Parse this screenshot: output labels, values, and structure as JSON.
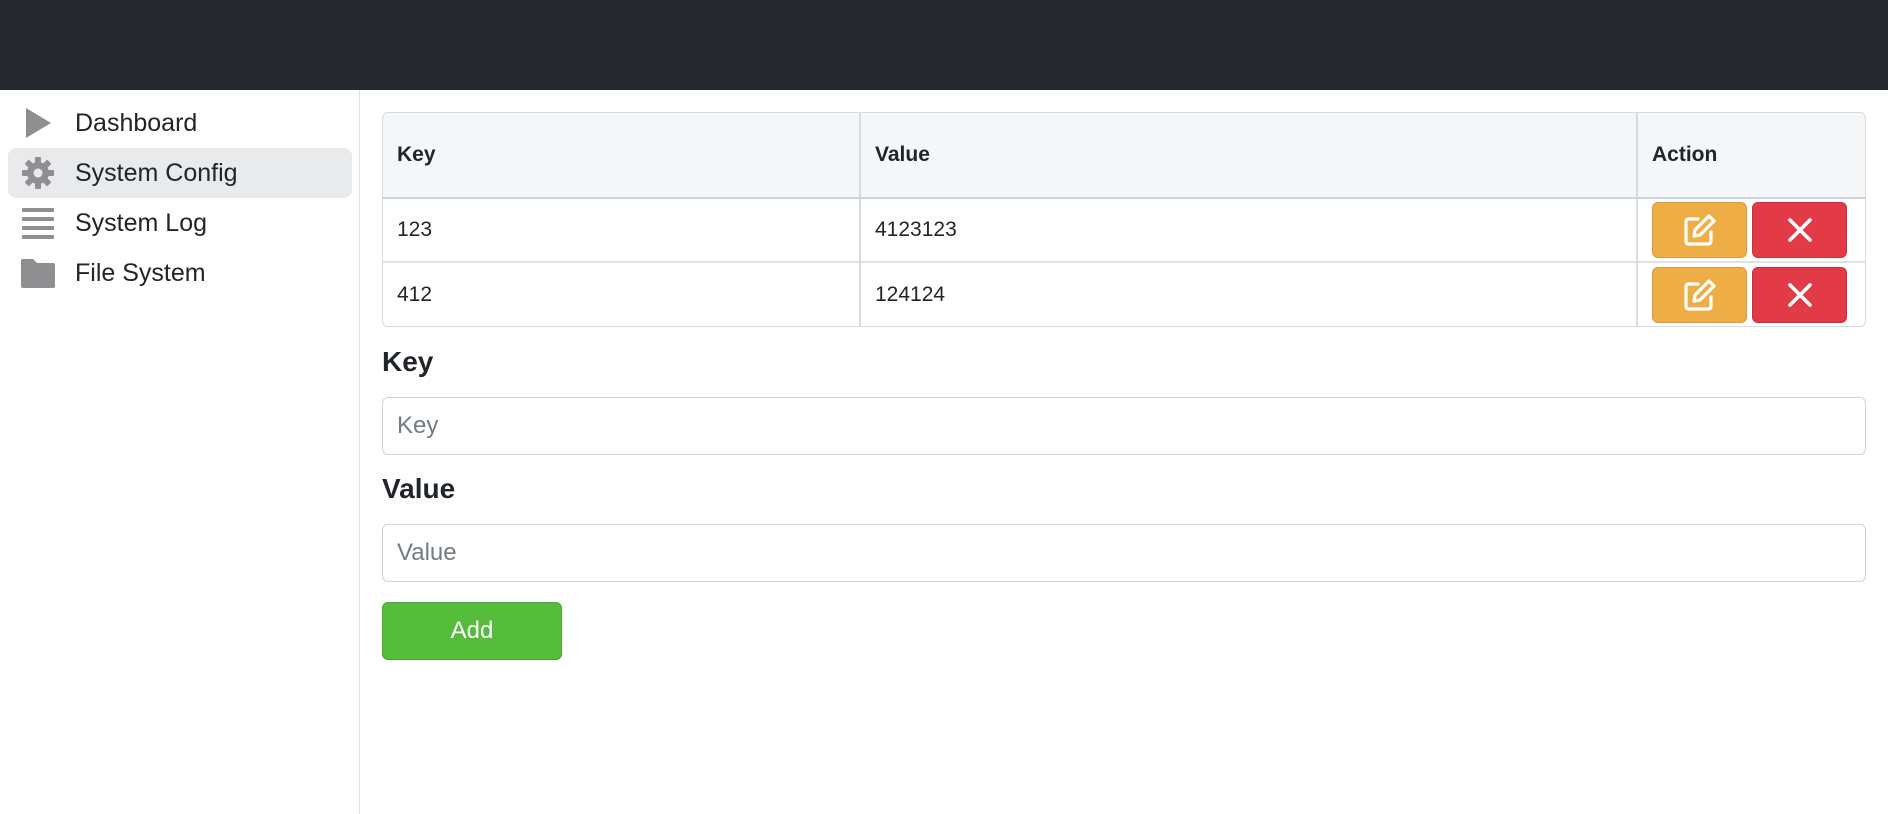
{
  "sidebar": {
    "items": [
      {
        "label": "Dashboard",
        "icon": "play-icon",
        "active": false
      },
      {
        "label": "System Config",
        "icon": "gear-icon",
        "active": true
      },
      {
        "label": "System Log",
        "icon": "list-icon",
        "active": false
      },
      {
        "label": "File System",
        "icon": "folder-icon",
        "active": false
      }
    ]
  },
  "table": {
    "headers": {
      "key": "Key",
      "value": "Value",
      "action": "Action"
    },
    "rows": [
      {
        "key": "123",
        "value": "4123123"
      },
      {
        "key": "412",
        "value": "124124"
      }
    ],
    "actions": {
      "edit_icon": "edit-icon",
      "delete_icon": "close-icon"
    }
  },
  "form": {
    "key_label": "Key",
    "key_placeholder": "Key",
    "key_value": "",
    "value_label": "Value",
    "value_placeholder": "Value",
    "value_value": "",
    "add_label": "Add"
  },
  "colors": {
    "topbar": "#25282d",
    "edit": "#efae45",
    "delete": "#e23a46",
    "add": "#55bc3c",
    "active_nav": "#e9eaec"
  }
}
